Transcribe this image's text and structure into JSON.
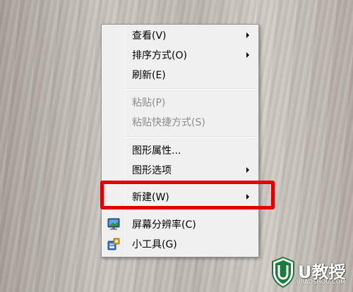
{
  "context_menu": {
    "items": [
      {
        "label": "查看(V)",
        "submenu": true,
        "enabled": true
      },
      {
        "label": "排序方式(O)",
        "submenu": true,
        "enabled": true
      },
      {
        "label": "刷新(E)",
        "submenu": false,
        "enabled": true
      },
      {
        "label": "粘贴(P)",
        "submenu": false,
        "enabled": false
      },
      {
        "label": "粘贴快捷方式(S)",
        "submenu": false,
        "enabled": false
      },
      {
        "label": "图形属性...",
        "submenu": false,
        "enabled": true
      },
      {
        "label": "图形选项",
        "submenu": true,
        "enabled": true
      },
      {
        "label": "新建(W)",
        "submenu": true,
        "enabled": true,
        "highlighted": true
      },
      {
        "label": "屏幕分辨率(C)",
        "submenu": false,
        "enabled": true,
        "icon": "monitor-icon"
      },
      {
        "label": "小工具(G)",
        "submenu": false,
        "enabled": true,
        "icon": "gadgets-icon"
      }
    ]
  },
  "watermark": {
    "brand": "U教授",
    "site": "UJIAOSHOU.COM",
    "colors": {
      "shield": "#1d7a3a",
      "text": "#ffffff"
    }
  },
  "annotation_color": "#e00000"
}
